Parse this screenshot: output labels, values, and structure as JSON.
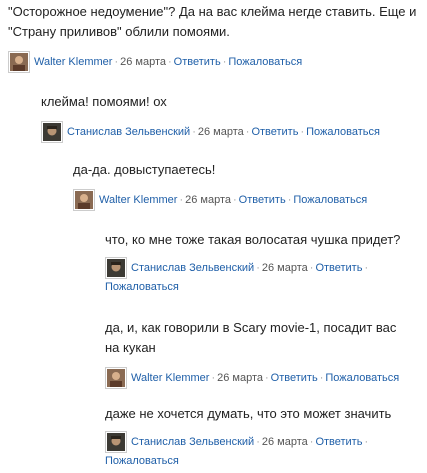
{
  "comments": [
    {
      "text": "\"Осторожное недоумение\"? Да на вас клейма негде ставить. Еще и \"Страну приливов\" облили помоями.",
      "author": "Walter Klemmer",
      "date": "26 марта",
      "reply": "Ответить",
      "report": "Пожаловаться",
      "avatar": "avatar-walter"
    },
    {
      "text": "клейма! помоями! ох",
      "author": "Станислав Зельвенский",
      "date": "26 марта",
      "reply": "Ответить",
      "report": "Пожаловаться",
      "avatar": "avatar-stanislav"
    },
    {
      "text": "да-да. довыступаетесь!",
      "author": "Walter Klemmer",
      "date": "26 марта",
      "reply": "Ответить",
      "report": "Пожаловаться",
      "avatar": "avatar-walter"
    },
    {
      "text": "что, ко мне тоже такая волосатая чушка придет?",
      "author": "Станислав Зельвенский",
      "date": "26 марта",
      "reply": "Ответить",
      "report": "Пожаловаться",
      "avatar": "avatar-stanislav"
    },
    {
      "text": "да, и, как говорили в Scary movie-1, посадит вас на кукан",
      "author": "Walter Klemmer",
      "date": "26 марта",
      "reply": "Ответить",
      "report": "Пожаловаться",
      "avatar": "avatar-walter"
    },
    {
      "text": "даже не хочется думать, что это может значить",
      "author": "Станислав Зельвенский",
      "date": "26 марта",
      "reply": "Ответить",
      "report": "Пожаловаться",
      "avatar": "avatar-stanislav"
    }
  ],
  "separator": "·",
  "colors": {
    "link": "#1f5fa8",
    "text": "#222222",
    "meta": "#555555"
  }
}
